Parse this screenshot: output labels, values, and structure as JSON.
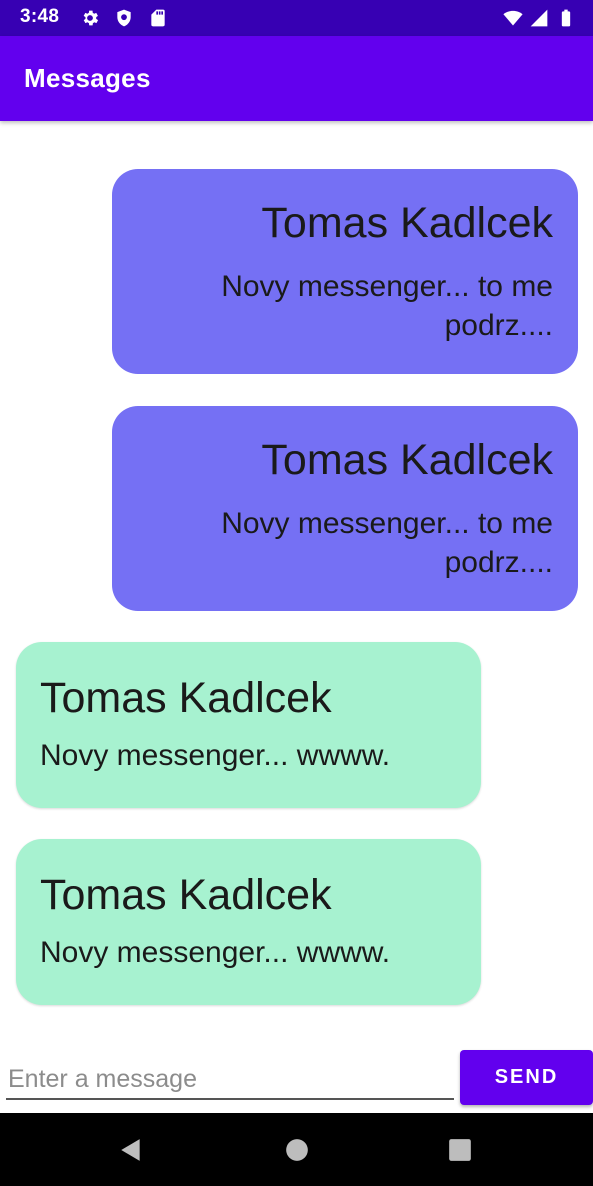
{
  "status_bar": {
    "time": "3:48",
    "icons": [
      "gear-icon",
      "shield-icon",
      "sd-card-icon",
      "wifi-icon",
      "cellular-signal-icon",
      "battery-icon"
    ]
  },
  "app_bar": {
    "title": "Messages"
  },
  "messages": [
    {
      "direction": "sent",
      "sender": "Tomas Kadlcek",
      "text_line1": "Novy messenger... to me",
      "text_line2": "podrz....",
      "color": "#7570f4"
    },
    {
      "direction": "sent",
      "sender": "Tomas Kadlcek",
      "text_line1": "Novy messenger... to me",
      "text_line2": "podrz....",
      "color": "#7570f4"
    },
    {
      "direction": "received",
      "sender": "Tomas Kadlcek",
      "text": "Novy messenger... wwww.",
      "color": "#a7f2d0"
    },
    {
      "direction": "received",
      "sender": "Tomas Kadlcek",
      "text": "Novy messenger... wwww.",
      "color": "#a7f2d0"
    }
  ],
  "composer": {
    "value": "",
    "placeholder": "Enter a message",
    "send_label": "SEND"
  },
  "nav_bar": {
    "buttons": [
      "back-icon",
      "home-icon",
      "recents-icon"
    ]
  },
  "colors": {
    "status_bar": "#3700b3",
    "primary": "#6200ee",
    "sent_bubble": "#7570f4",
    "received_bubble": "#a7f2d0"
  }
}
